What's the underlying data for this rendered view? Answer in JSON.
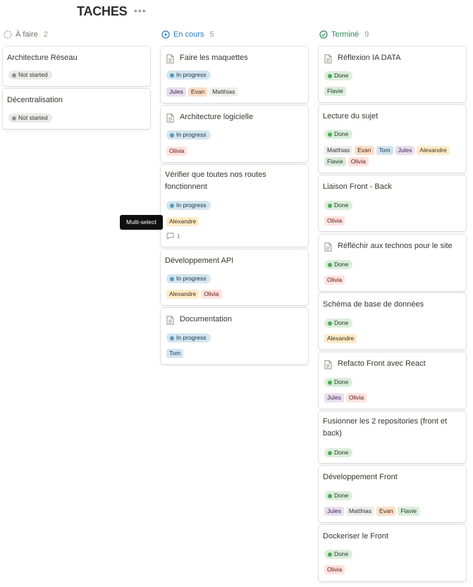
{
  "board": {
    "title": "TACHES",
    "more_icon": "ellipsis-icon"
  },
  "colors": {
    "not_started": "#91918e",
    "in_progress": "#5b97bd",
    "done": "#4daa57",
    "in_progress_label": "#2b7bbf",
    "done_label": "#2f8a5a"
  },
  "columns": [
    {
      "label": "À faire",
      "count": "2",
      "icon": "circle-dashed-icon"
    },
    {
      "label": "En cours",
      "count": "5",
      "icon": "play-circle-icon"
    },
    {
      "label": "Terminé",
      "count": "9",
      "icon": "check-circle-icon"
    }
  ],
  "cards": [
    {
      "title": "Architecture Réseau",
      "status": "Not started",
      "tags": []
    },
    {
      "title": "Décentralisation",
      "status": "Not started",
      "tags": []
    },
    {
      "title": "Faire les maquettes",
      "status": "In progress",
      "doc_icon": true,
      "tags": [
        "Jules",
        "Evan",
        "Matthias"
      ]
    },
    {
      "title": "Architecture logicielle",
      "status": "In progress",
      "doc_icon": true,
      "tags": [
        "Olivia"
      ]
    },
    {
      "title": "Vérifier que toutes nos routes fonctionnent",
      "status": "In progress",
      "tags": [
        "Alexandre"
      ],
      "comments": "1"
    },
    {
      "title": "Développement API",
      "status": "In progress",
      "tags": [
        "Alexandre",
        "Olivia"
      ]
    },
    {
      "title": "Documentation",
      "status": "In progress",
      "doc_icon": true,
      "tags": [
        "Tom"
      ]
    },
    {
      "title": "Réflexion IA DATA",
      "status": "Done",
      "doc_icon": true,
      "tags": [
        "Flavie"
      ]
    },
    {
      "title": "Lecture du sujet",
      "status": "Done",
      "tags": [
        "Matthias",
        "Evan",
        "Tom",
        "Jules",
        "Alexandre",
        "Flavie",
        "Olivia"
      ]
    },
    {
      "title": "Liaison Front - Back",
      "status": "Done",
      "tags": [
        "Olivia"
      ]
    },
    {
      "title": "Réfléchir aux technos pour le site",
      "status": "Done",
      "doc_icon": true,
      "tags": [
        "Olivia"
      ]
    },
    {
      "title": "Schéma de base de données",
      "status": "Done",
      "tags": [
        "Alexandre"
      ]
    },
    {
      "title": "Refacto Front avec React",
      "status": "Done",
      "doc_icon": true,
      "tags": [
        "Jules",
        "Olivia"
      ]
    },
    {
      "title": "Fusionner les 2 repositories (front et back)",
      "status": "Done",
      "tags": []
    },
    {
      "title": "Développement Front",
      "status": "Done",
      "tags": [
        "Jules",
        "Matthias",
        "Evan",
        "Flavie"
      ]
    },
    {
      "title": "Dockeriser le Front",
      "status": "Done",
      "tags": [
        "Olivia"
      ]
    }
  ],
  "tooltip": {
    "text": "Multi-select"
  }
}
